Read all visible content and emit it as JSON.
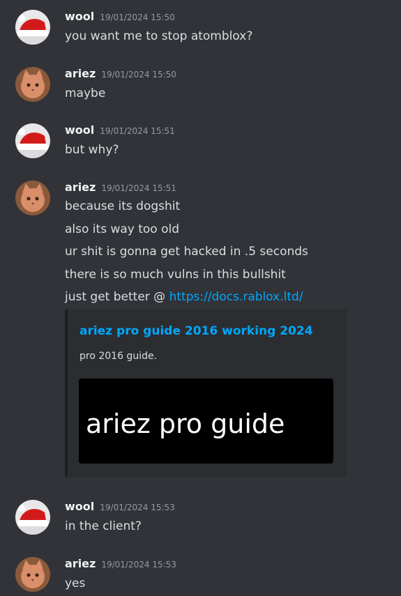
{
  "colors": {
    "background": "#313338",
    "author": "#f2f3f5",
    "timestamp": "#949ba4",
    "text": "#dbdee1",
    "link": "#00a8fc",
    "embed_bg": "#2b2d31",
    "embed_border": "#1e1f22"
  },
  "messages": [
    {
      "author": "wool",
      "time": "19/01/2024 15:50",
      "lines": [
        "you want me to stop atomblox?"
      ],
      "avatar": "santa-hat-avatar-icon"
    },
    {
      "author": "ariez",
      "time": "19/01/2024 15:50",
      "lines": [
        "maybe"
      ],
      "avatar": "cat-avatar-icon"
    },
    {
      "author": "wool",
      "time": "19/01/2024 15:51",
      "lines": [
        "but why?"
      ],
      "avatar": "santa-hat-avatar-icon"
    },
    {
      "author": "ariez",
      "time": "19/01/2024 15:51",
      "avatar": "cat-avatar-icon",
      "lines": [
        "because its dogshit",
        "also its way too old",
        "ur shit is gonna get hacked in .5 seconds",
        "there is so much vulns in this bullshit"
      ],
      "link_line_prefix": "just get better @ ",
      "link": "https://docs.rablox.ltd/",
      "embed": {
        "title": "ariez pro guide 2016 working 2024",
        "description": "pro 2016 guide.",
        "image_text": "ariez pro guide"
      }
    },
    {
      "author": "wool",
      "time": "19/01/2024 15:53",
      "lines": [
        "in the client?"
      ],
      "avatar": "santa-hat-avatar-icon"
    },
    {
      "author": "ariez",
      "time": "19/01/2024 15:53",
      "lines": [
        "yes"
      ],
      "avatar": "cat-avatar-icon"
    }
  ]
}
